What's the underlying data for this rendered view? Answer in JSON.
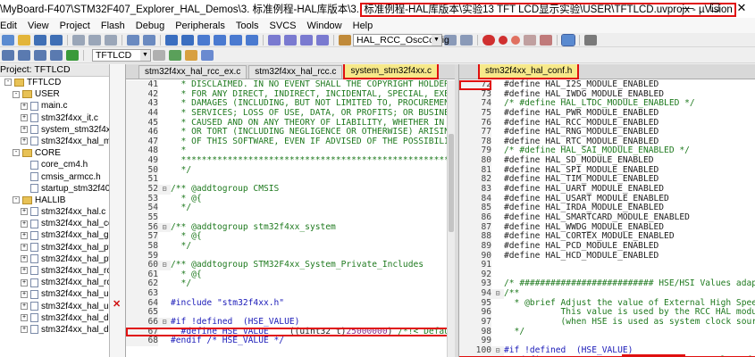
{
  "window": {
    "title_prefix": "\\MyBoard-F407\\STM32F407_Explorer_HAL_Demos\\3. 标准例程-HAL库版本\\3. ",
    "title_highlight": "标准例程-HAL库版本\\实验13 TFT LCD显示实验\\USER\\TFTLCD.uvprojx - µVision",
    "controls": [
      "—",
      "☐",
      "✕"
    ]
  },
  "menu": [
    "Edit",
    "View",
    "Project",
    "Flash",
    "Debug",
    "Peripherals",
    "Tools",
    "SVCS",
    "Window",
    "Help"
  ],
  "toolbar": {
    "target_combo": "HAL_RCC_OscConfig",
    "project_target": "TFTLCD"
  },
  "sidebar": {
    "header": "Project: TFTLCD",
    "items": [
      {
        "label": "Project: TFTLCD",
        "kind": "project",
        "indent": 0,
        "expand": "-"
      },
      {
        "label": "TFTLCD",
        "kind": "folder",
        "indent": 1,
        "expand": "-"
      },
      {
        "label": "USER",
        "kind": "folder",
        "indent": 2,
        "expand": "-"
      },
      {
        "label": "main.c",
        "kind": "file",
        "indent": 3,
        "expand": "+"
      },
      {
        "label": "stm32f4xx_it.c",
        "kind": "file",
        "indent": 3,
        "expand": "+"
      },
      {
        "label": "system_stm32f4xx.c",
        "kind": "file",
        "indent": 3,
        "expand": "+"
      },
      {
        "label": "stm32f4xx_hal_msp.c",
        "kind": "file",
        "indent": 3,
        "expand": "+"
      },
      {
        "label": "CORE",
        "kind": "folder",
        "indent": 2,
        "expand": "-"
      },
      {
        "label": "core_cm4.h",
        "kind": "file",
        "indent": 3,
        "expand": ""
      },
      {
        "label": "cmsis_armcc.h",
        "kind": "file",
        "indent": 3,
        "expand": ""
      },
      {
        "label": "startup_stm32f407xx",
        "kind": "file",
        "indent": 3,
        "expand": ""
      },
      {
        "label": "HALLIB",
        "kind": "folder",
        "indent": 2,
        "expand": "-"
      },
      {
        "label": "stm32f4xx_hal.c",
        "kind": "file",
        "indent": 3,
        "expand": "+"
      },
      {
        "label": "stm32f4xx_hal_corte",
        "kind": "file",
        "indent": 3,
        "expand": "+"
      },
      {
        "label": "stm32f4xx_hal_gpio.",
        "kind": "file",
        "indent": 3,
        "expand": "+"
      },
      {
        "label": "stm32f4xx_hal_pwr.",
        "kind": "file",
        "indent": 3,
        "expand": "+"
      },
      {
        "label": "stm32f4xx_hal_pwr_e",
        "kind": "file",
        "indent": 3,
        "expand": "+"
      },
      {
        "label": "stm32f4xx_hal_rcc.c",
        "kind": "file",
        "indent": 3,
        "expand": "+"
      },
      {
        "label": "stm32f4xx_hal_rcc_e",
        "kind": "file",
        "indent": 3,
        "expand": "+"
      },
      {
        "label": "stm32f4xx_hal_uart.c",
        "kind": "file",
        "indent": 3,
        "expand": "+"
      },
      {
        "label": "stm32f4xx_hal_usart.",
        "kind": "file",
        "indent": 3,
        "expand": "+"
      },
      {
        "label": "stm32f4xx_hal_dma.",
        "kind": "file",
        "indent": 3,
        "expand": "+"
      },
      {
        "label": "stm32f4xx_hal_dma.",
        "kind": "file",
        "indent": 3,
        "expand": "+"
      }
    ]
  },
  "left_editor": {
    "tabs": [
      {
        "label": "stm32f4xx_hal_rcc_ex.c",
        "active": false,
        "highlight": false
      },
      {
        "label": "stm32f4xx_hal_rcc.c",
        "active": false,
        "highlight": false
      },
      {
        "label": "system_stm32f4xx.c",
        "active": true,
        "highlight": true
      }
    ],
    "lines": [
      {
        "n": "41",
        "f": "",
        "t": "  * DISCLAIMED. IN NO EVENT SHALL THE COPYRIGHT HOLDER OR",
        "c": "green"
      },
      {
        "n": "42",
        "f": "",
        "t": "  * FOR ANY DIRECT, INDIRECT, INCIDENTAL, SPECIAL, EXEMPL",
        "c": "green"
      },
      {
        "n": "43",
        "f": "",
        "t": "  * DAMAGES (INCLUDING, BUT NOT LIMITED TO, PROCUREMENT O",
        "c": "green"
      },
      {
        "n": "44",
        "f": "",
        "t": "  * SERVICES; LOSS OF USE, DATA, OR PROFITS; OR BUSINESS",
        "c": "green"
      },
      {
        "n": "45",
        "f": "",
        "t": "  * CAUSED AND ON ANY THEORY OF LIABILITY, WHETHER IN CON",
        "c": "green"
      },
      {
        "n": "46",
        "f": "",
        "t": "  * OR TORT (INCLUDING NEGLIGENCE OR OTHERWISE) ARISING I",
        "c": "green"
      },
      {
        "n": "47",
        "f": "",
        "t": "  * OF THIS SOFTWARE, EVEN IF ADVISED OF THE POSSIBILITY",
        "c": "green"
      },
      {
        "n": "48",
        "f": "",
        "t": "  *",
        "c": "green"
      },
      {
        "n": "49",
        "f": "",
        "t": "  ****************************************************",
        "c": "green"
      },
      {
        "n": "50",
        "f": "",
        "t": "  */",
        "c": "green"
      },
      {
        "n": "51",
        "f": "",
        "t": "",
        "c": "green"
      },
      {
        "n": "52",
        "f": "⊟",
        "t": "/** @addtogroup CMSIS",
        "c": "green"
      },
      {
        "n": "53",
        "f": "",
        "t": "  * @{",
        "c": "green"
      },
      {
        "n": "54",
        "f": "",
        "t": "  */",
        "c": "green"
      },
      {
        "n": "55",
        "f": "",
        "t": "",
        "c": "green"
      },
      {
        "n": "56",
        "f": "⊟",
        "t": "/** @addtogroup stm32f4xx_system",
        "c": "green"
      },
      {
        "n": "57",
        "f": "",
        "t": "  * @{",
        "c": "green"
      },
      {
        "n": "58",
        "f": "",
        "t": "  */",
        "c": "green"
      },
      {
        "n": "59",
        "f": "",
        "t": "",
        "c": "green"
      },
      {
        "n": "60",
        "f": "⊟",
        "t": "/** @addtogroup STM32F4xx_System_Private_Includes",
        "c": "green"
      },
      {
        "n": "61",
        "f": "",
        "t": "  * @{",
        "c": "green"
      },
      {
        "n": "62",
        "f": "",
        "t": "  */",
        "c": "green"
      },
      {
        "n": "63",
        "f": "",
        "t": "",
        "c": "green"
      },
      {
        "n": "64",
        "f": "",
        "t": "#include \"stm32f4xx.h\"",
        "c": "blue",
        "bp": true
      },
      {
        "n": "65",
        "f": "",
        "t": "",
        "c": "green"
      },
      {
        "n": "66",
        "f": "⊟",
        "t": "#if !defined  (HSE_VALUE)",
        "c": "blue"
      },
      {
        "n": "67",
        "f": "",
        "t": "  #define HSE_VALUE    ((uint32_t)25000000) /*!< Default",
        "c": "mixed",
        "highlight": true
      },
      {
        "n": "68",
        "f": "",
        "t": "#endif /* HSE_VALUE */",
        "c": "blue"
      }
    ]
  },
  "right_editor": {
    "tabs": [
      {
        "label": "stm32f4xx_hal_conf.h",
        "active": true,
        "highlight": true
      }
    ],
    "lines": [
      {
        "n": "72",
        "t": "#define HAL_I2S_MODULE_ENABLED",
        "c": "dark",
        "nhl": true
      },
      {
        "n": "73",
        "t": "#define HAL_IWDG_MODULE_ENABLED",
        "c": "dark"
      },
      {
        "n": "74",
        "t": "/* #define HAL_LTDC_MODULE_ENABLED */",
        "c": "green"
      },
      {
        "n": "75",
        "t": "#define HAL_PWR_MODULE_ENABLED",
        "c": "dark"
      },
      {
        "n": "76",
        "t": "#define HAL_RCC_MODULE_ENABLED",
        "c": "dark"
      },
      {
        "n": "77",
        "t": "#define HAL_RNG_MODULE_ENABLED",
        "c": "dark"
      },
      {
        "n": "78",
        "t": "#define HAL_RTC_MODULE_ENABLED",
        "c": "dark"
      },
      {
        "n": "79",
        "t": "/* #define HAL_SAI_MODULE_ENABLED */",
        "c": "green"
      },
      {
        "n": "80",
        "t": "#define HAL_SD_MODULE_ENABLED",
        "c": "dark"
      },
      {
        "n": "81",
        "t": "#define HAL_SPI_MODULE_ENABLED",
        "c": "dark"
      },
      {
        "n": "82",
        "t": "#define HAL_TIM_MODULE_ENABLED",
        "c": "dark"
      },
      {
        "n": "83",
        "t": "#define HAL_UART_MODULE_ENABLED",
        "c": "dark"
      },
      {
        "n": "84",
        "t": "#define HAL_USART_MODULE_ENABLED",
        "c": "dark"
      },
      {
        "n": "85",
        "t": "#define HAL_IRDA_MODULE_ENABLED",
        "c": "dark"
      },
      {
        "n": "86",
        "t": "#define HAL_SMARTCARD_MODULE_ENABLED",
        "c": "dark"
      },
      {
        "n": "87",
        "t": "#define HAL_WWDG_MODULE_ENABLED",
        "c": "dark"
      },
      {
        "n": "88",
        "t": "#define HAL_CORTEX_MODULE_ENABLED",
        "c": "dark"
      },
      {
        "n": "89",
        "t": "#define HAL_PCD_MODULE_ENABLED",
        "c": "dark"
      },
      {
        "n": "90",
        "t": "#define HAL_HCD_MODULE_ENABLED",
        "c": "dark"
      },
      {
        "n": "91",
        "t": "",
        "c": "dark"
      },
      {
        "n": "92",
        "t": "",
        "c": "dark"
      },
      {
        "n": "93",
        "t": "/* ########################## HSE/HSI Values adaptat",
        "c": "green"
      },
      {
        "n": "94",
        "t": "/**",
        "c": "green",
        "fold": "⊟"
      },
      {
        "n": "95",
        "t": "  * @brief Adjust the value of External High Speed o",
        "c": "green"
      },
      {
        "n": "96",
        "t": "           This value is used by the RCC HAL module t",
        "c": "green"
      },
      {
        "n": "97",
        "t": "           (when HSE is used as system clock source,",
        "c": "green"
      },
      {
        "n": "98",
        "t": "  */",
        "c": "green"
      },
      {
        "n": "99",
        "t": "",
        "c": "dark"
      },
      {
        "n": "100",
        "t": "#if !defined  (HSE_VALUE)",
        "c": "blue",
        "fold": "⊟"
      },
      {
        "n": "101",
        "t": "  #define HSE_VALUE    (25000000U) /*!< Value of th",
        "c": "mixed2",
        "highlight": true
      }
    ]
  },
  "colors": {
    "highlight_red": "#e01010",
    "comment_green": "#1f7a1f",
    "preproc_blue": "#1a1ab8",
    "active_tab": "#f7e98a"
  }
}
